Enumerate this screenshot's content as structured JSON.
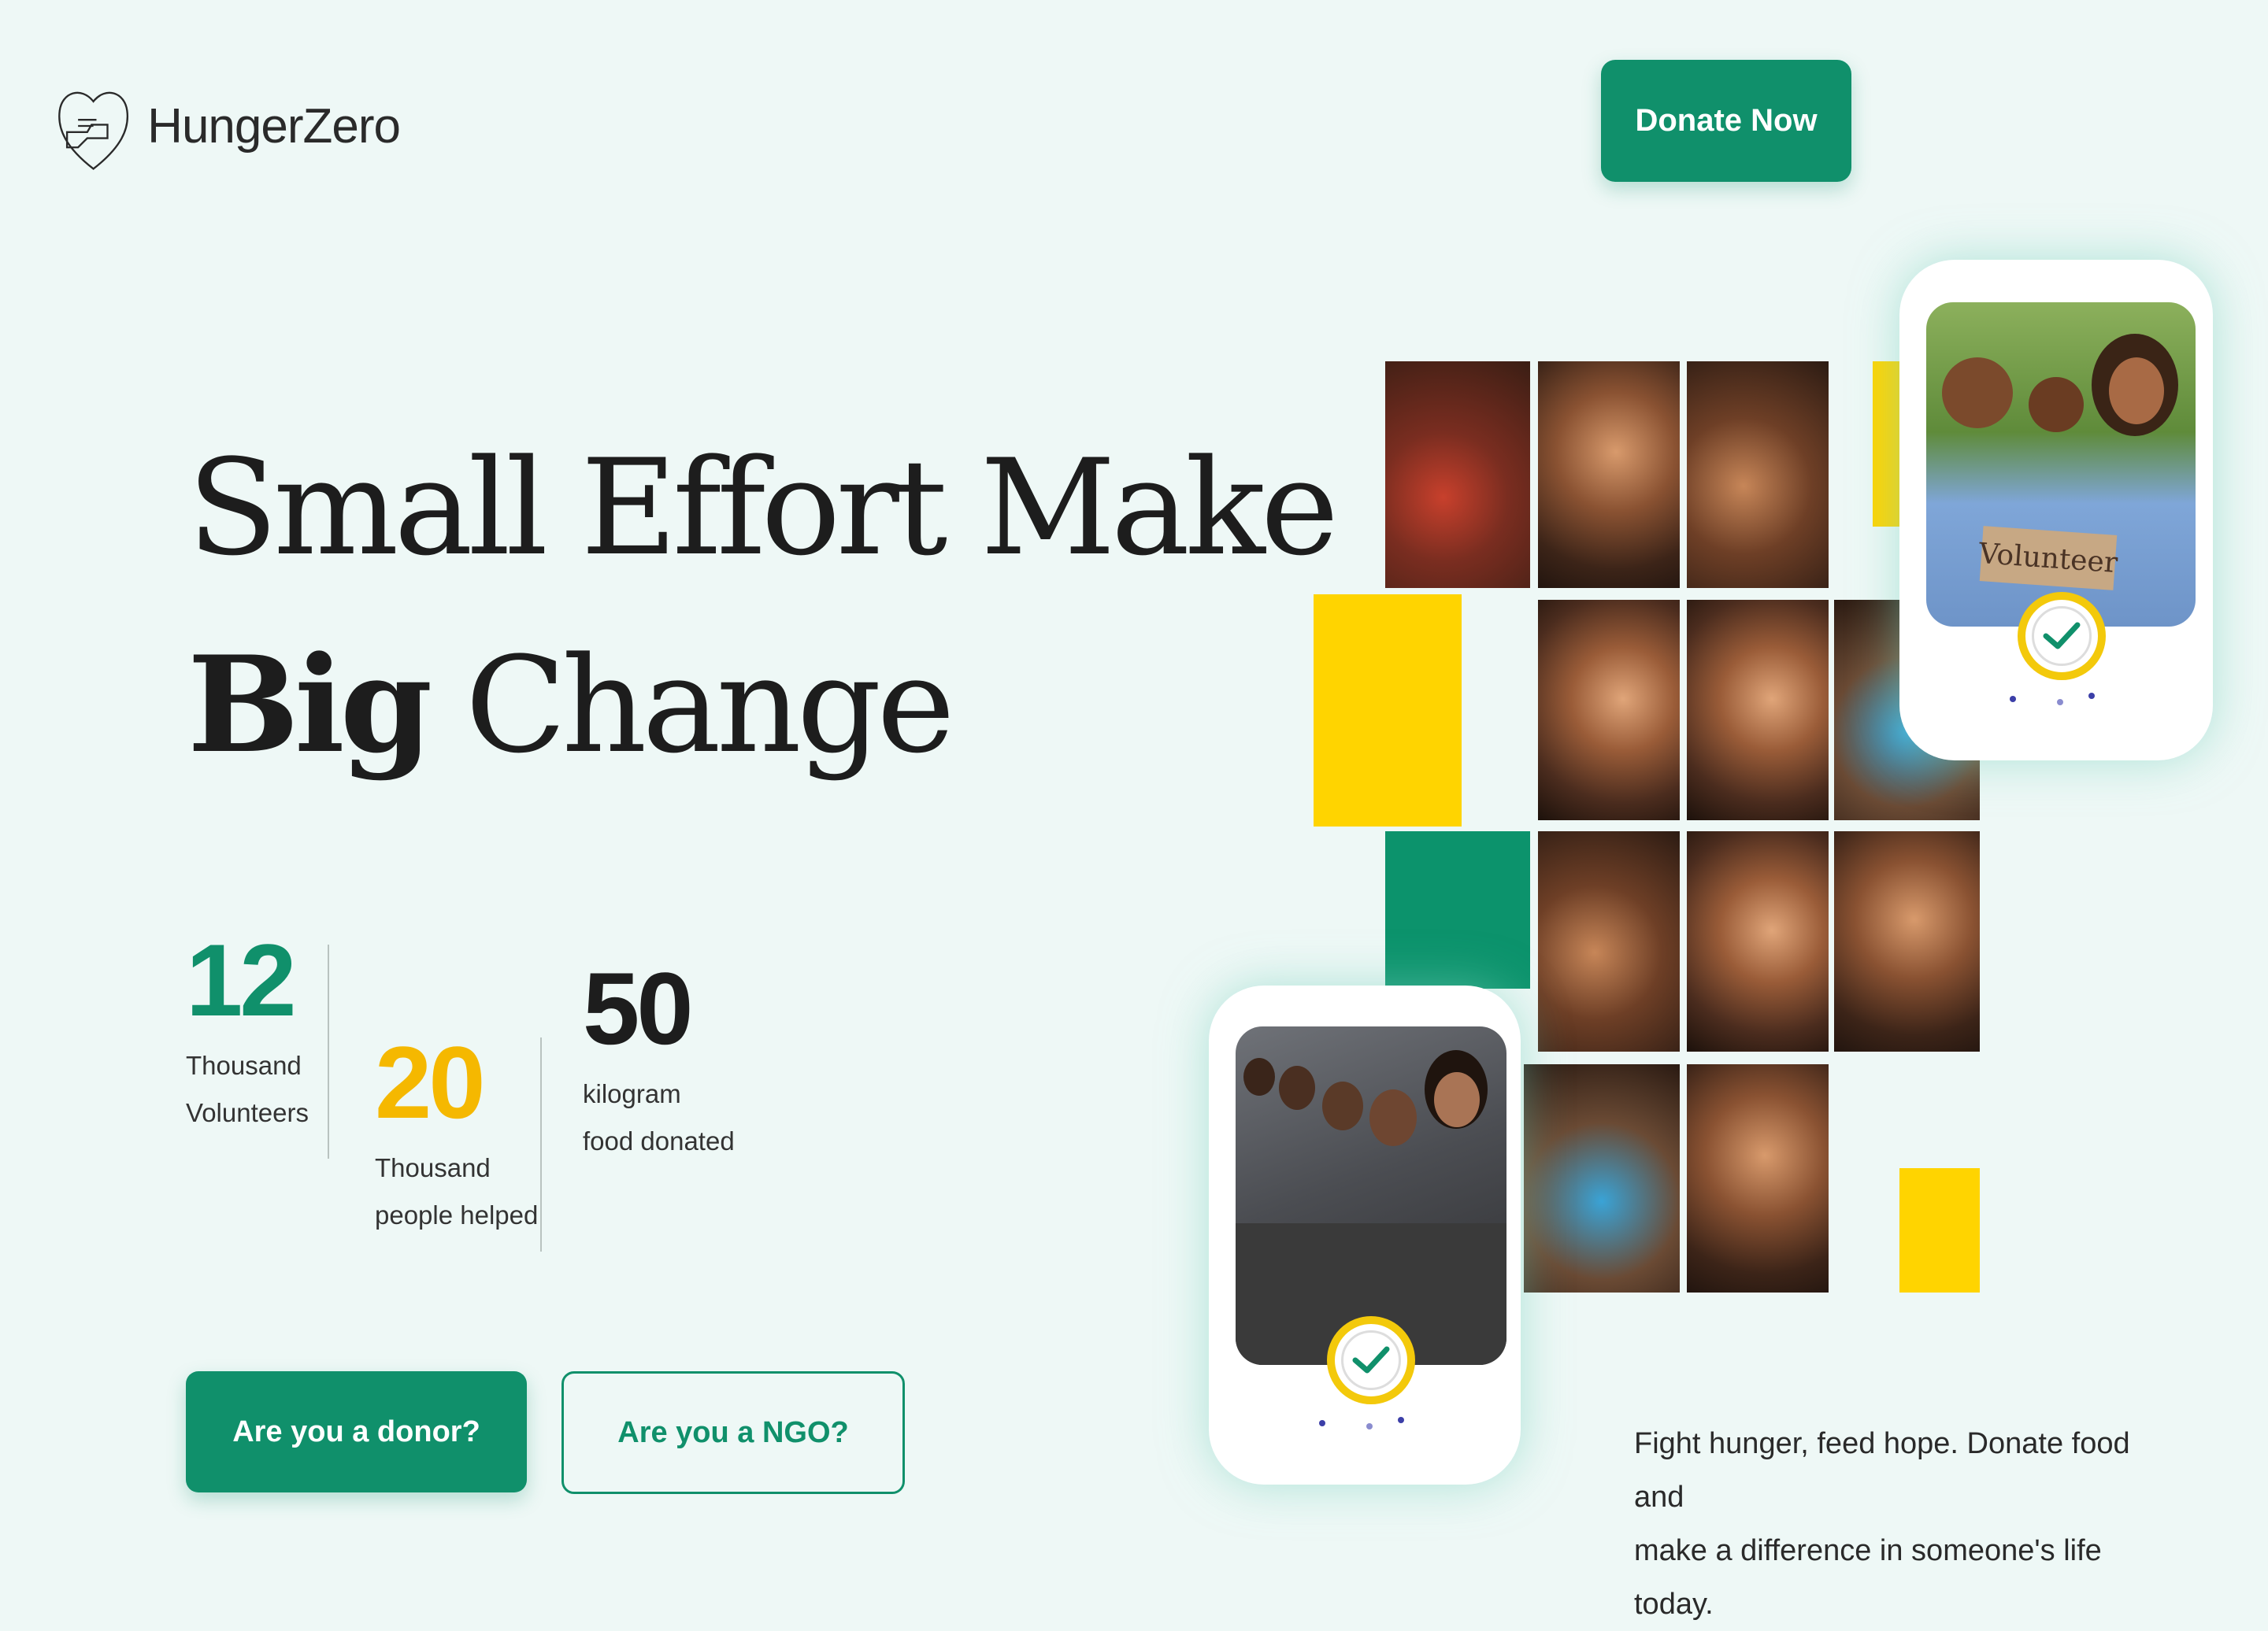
{
  "brand": {
    "name": "HungerZero",
    "logo_icon": "heart-hands-icon"
  },
  "header": {
    "donate_label": "Donate Now"
  },
  "hero": {
    "line1": "Small Effort Make",
    "line2_bold": "Big",
    "line2_rest": " Change"
  },
  "stats": [
    {
      "value": "12",
      "label_line1": "Thousand",
      "label_line2": "Volunteers",
      "color": "#10906b"
    },
    {
      "value": "20",
      "label_line1": "Thousand",
      "label_line2": "people helped",
      "color": "#f5b800"
    },
    {
      "value": "50",
      "label_line1": "kilogram",
      "label_line2": "food donated",
      "color": "#1d1d1d"
    }
  ],
  "cta": {
    "donor_label": "Are you a donor?",
    "ngo_label": "Are you a NGO?"
  },
  "volunteer_sign": "Volunteer",
  "tagline": {
    "line1": "Fight hunger, feed hope. Donate food and",
    "line2": "make a difference in someone's life today."
  },
  "colors": {
    "primary": "#10906b",
    "accent_yellow": "#ffd400",
    "background": "#eef8f6"
  }
}
